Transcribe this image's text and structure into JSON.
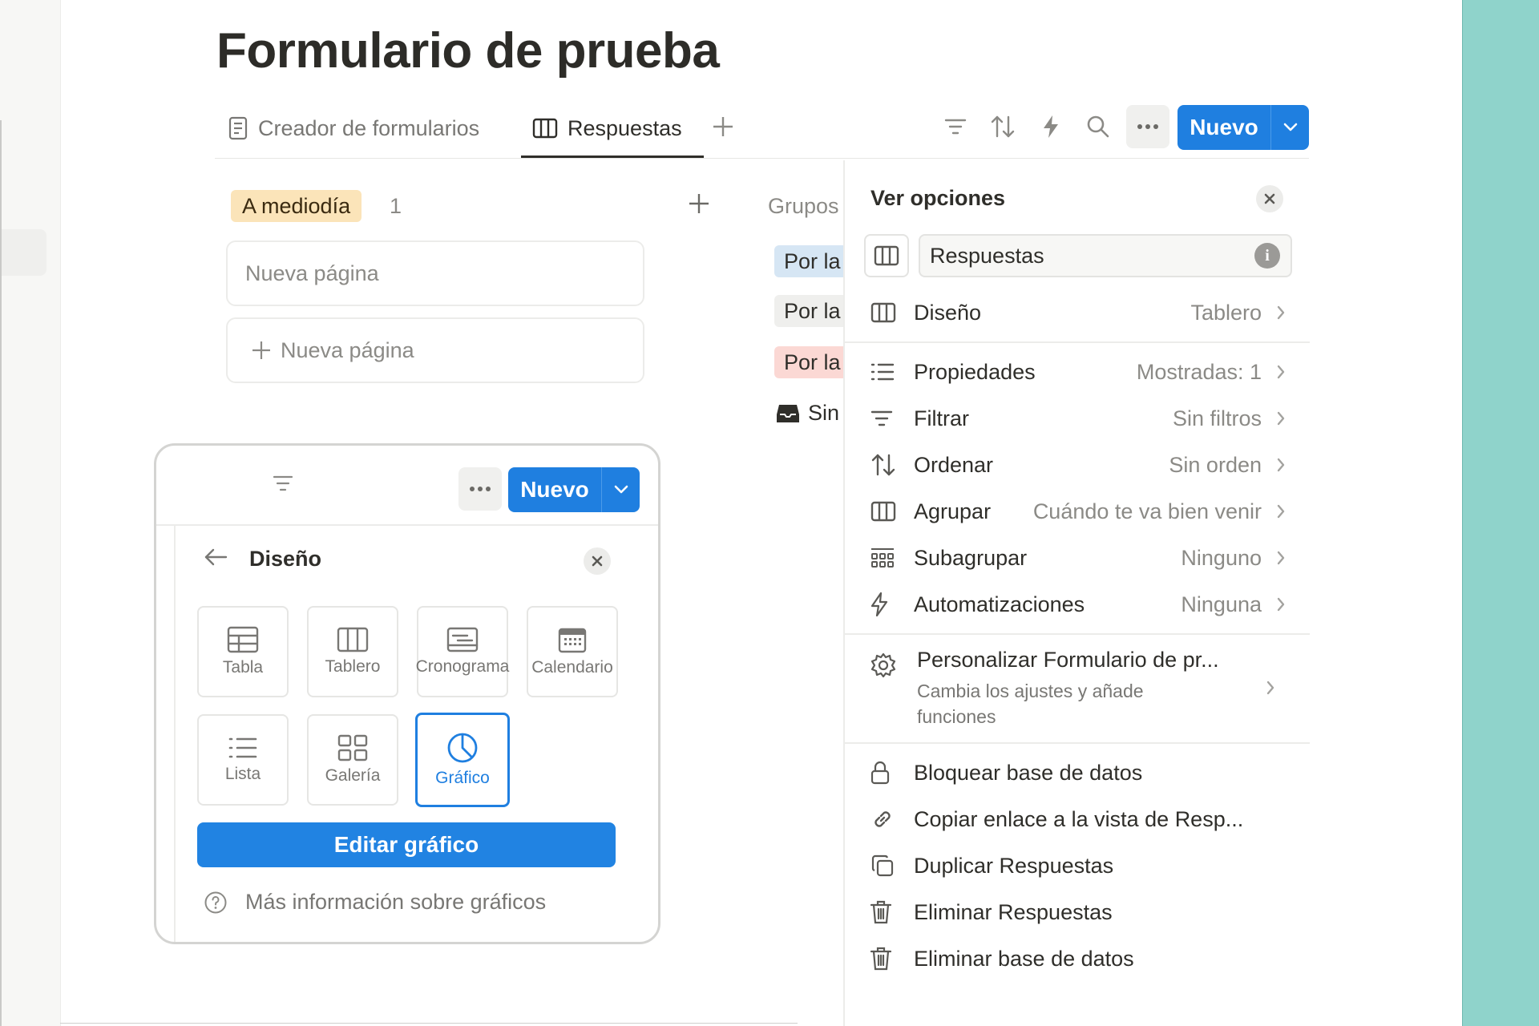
{
  "page": {
    "title": "Formulario de prueba"
  },
  "tabs": [
    {
      "label": "Creador de formularios",
      "icon": "document-icon"
    },
    {
      "label": "Respuestas",
      "icon": "board-icon",
      "active": true
    }
  ],
  "toolbar": {
    "new_label": "Nuevo"
  },
  "board": {
    "group": {
      "label": "A mediodía",
      "count": "1",
      "color": "#fbe4b9"
    },
    "card_title": "Nueva página",
    "new_page_label": "Nueva página",
    "groups_label": "Grupos",
    "group_items": [
      {
        "label": "Por la",
        "color": "#d6e6f4"
      },
      {
        "label": "Por la",
        "color": "#efefed"
      },
      {
        "label": "Por la",
        "color": "#fbd8d4"
      },
      {
        "label": "Sin",
        "icon": "inbox-icon"
      }
    ]
  },
  "view_options": {
    "title": "Ver opciones",
    "view_name": "Respuestas",
    "rows": [
      {
        "label": "Diseño",
        "value": "Tablero",
        "icon": "board-icon"
      },
      {
        "label": "Propiedades",
        "value": "Mostradas: 1",
        "icon": "list-icon"
      },
      {
        "label": "Filtrar",
        "value": "Sin filtros",
        "icon": "filter-icon"
      },
      {
        "label": "Ordenar",
        "value": "Sin orden",
        "icon": "sort-icon"
      },
      {
        "label": "Agrupar",
        "value": "Cuándo te va bien venir",
        "icon": "board-icon"
      },
      {
        "label": "Subagrupar",
        "value": "Ninguno",
        "icon": "subgroup-icon"
      },
      {
        "label": "Automatizaciones",
        "value": "Ninguna",
        "icon": "lightning-icon"
      }
    ],
    "customize": {
      "title": "Personalizar Formulario de pr...",
      "subtitle": "Cambia los ajustes y añade funciones"
    },
    "actions": [
      {
        "label": "Bloquear base de datos",
        "icon": "lock-icon"
      },
      {
        "label": "Copiar enlace a la vista de Resp...",
        "icon": "link-icon"
      },
      {
        "label": "Duplicar Respuestas",
        "icon": "duplicate-icon"
      },
      {
        "label": "Eliminar Respuestas",
        "icon": "trash-icon"
      },
      {
        "label": "Eliminar base de datos",
        "icon": "trash-icon"
      }
    ]
  },
  "layout_popup": {
    "new_label": "Nuevo",
    "title": "Diseño",
    "options": [
      {
        "label": "Tabla",
        "icon": "table-icon"
      },
      {
        "label": "Tablero",
        "icon": "board-icon"
      },
      {
        "label": "Cronograma",
        "icon": "timeline-icon"
      },
      {
        "label": "Calendario",
        "icon": "calendar-icon"
      },
      {
        "label": "Lista",
        "icon": "list-icon"
      },
      {
        "label": "Galería",
        "icon": "gallery-icon"
      },
      {
        "label": "Gráfico",
        "icon": "chart-icon",
        "selected": true
      }
    ],
    "edit_button": "Editar gráfico",
    "help_text": "Más información sobre gráficos"
  },
  "colors": {
    "accent": "#1f7fe0",
    "teal": "#8fd3cb"
  }
}
